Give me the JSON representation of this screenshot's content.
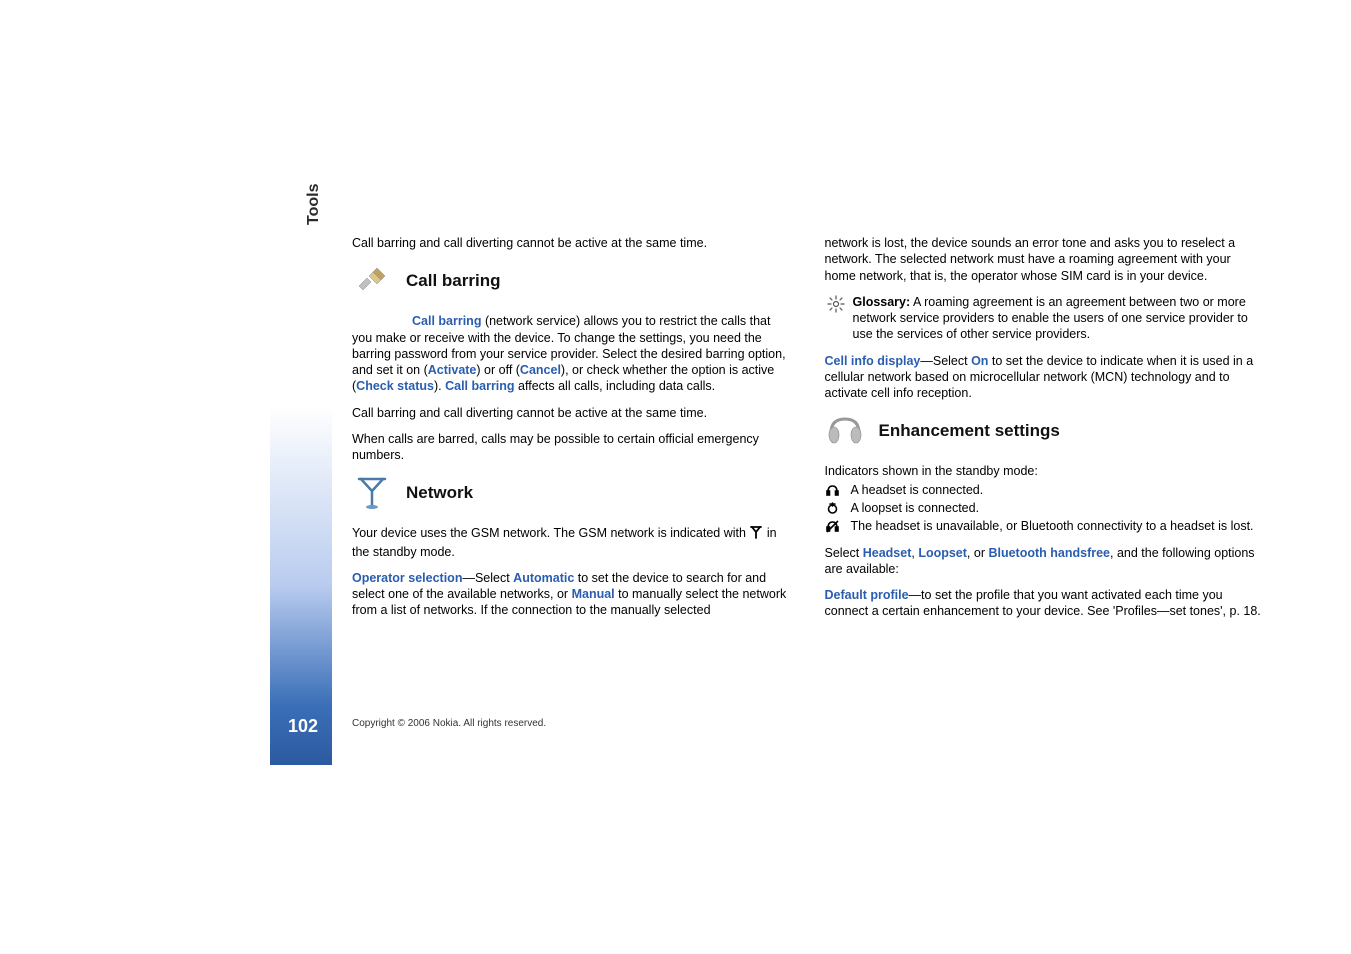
{
  "side_tab": "Tools",
  "page_number": "102",
  "copyright": "Copyright © 2006 Nokia. All rights reserved.",
  "col1": {
    "intro": "Call barring and call diverting cannot be active at the same time.",
    "callbarring_heading": "Call barring",
    "cb_p1_a": "Call barring",
    "cb_p1_b": " (network service) allows you to restrict the calls that you make or receive with the device. To change the settings, you need the barring password from your service provider. Select the desired barring option, and set it on (",
    "cb_p1_c": "Activate",
    "cb_p1_d": ") or off (",
    "cb_p1_e": "Cancel",
    "cb_p1_f": "), or check whether the option is active (",
    "cb_p1_g": "Check status",
    "cb_p1_h": "). ",
    "cb_p1_i": "Call barring",
    "cb_p1_j": " affects all calls, including data calls.",
    "cb_p2": "Call barring and call diverting cannot be active at the same time.",
    "cb_p3": "When calls are barred, calls may be possible to certain official emergency numbers.",
    "network_heading": "Network",
    "net_p1_a": "Your device uses the GSM network. The GSM network is indicated with ",
    "net_p1_b": " in the standby mode.",
    "net_p2_a": "Operator selection",
    "net_p2_b": "—Select ",
    "net_p2_c": "Automatic",
    "net_p2_d": " to set the device to search for and select one of the available networks, or ",
    "net_p2_e": "Manual",
    "net_p2_f": " to manually select the network from a list of networks. If the connection to the manually selected "
  },
  "col2": {
    "cont_p1": "network is lost, the device sounds an error tone and asks you to reselect a network. The selected network must have a roaming agreement with your home network, that is, the operator whose SIM card is in your device.",
    "glossary_label": "Glossary:",
    "glossary_text": " A roaming agreement is an agreement between two or more network service providers to enable the users of one service provider to use the services of other service providers.",
    "cell_a": "Cell info display",
    "cell_b": "—Select ",
    "cell_c": "On",
    "cell_d": " to set the device to indicate when it is used in a cellular network based on microcellular network (MCN) technology and to activate cell info reception.",
    "enh_heading": "Enhancement settings",
    "ind_intro": "Indicators shown in the standby mode:",
    "ind1": "A headset is connected.",
    "ind2": "A loopset is connected.",
    "ind3": "The headset is unavailable, or Bluetooth connectivity to a headset is lost.",
    "sel_a": "Select ",
    "sel_b": "Headset",
    "sel_c": ", ",
    "sel_d": "Loopset",
    "sel_e": ", or ",
    "sel_f": "Bluetooth handsfree",
    "sel_g": ", and the following options are available:",
    "def_a": "Default profile",
    "def_b": "—to set the profile that you want activated each time you connect a certain enhancement to your device. See 'Profiles—set tones', p. 18."
  }
}
